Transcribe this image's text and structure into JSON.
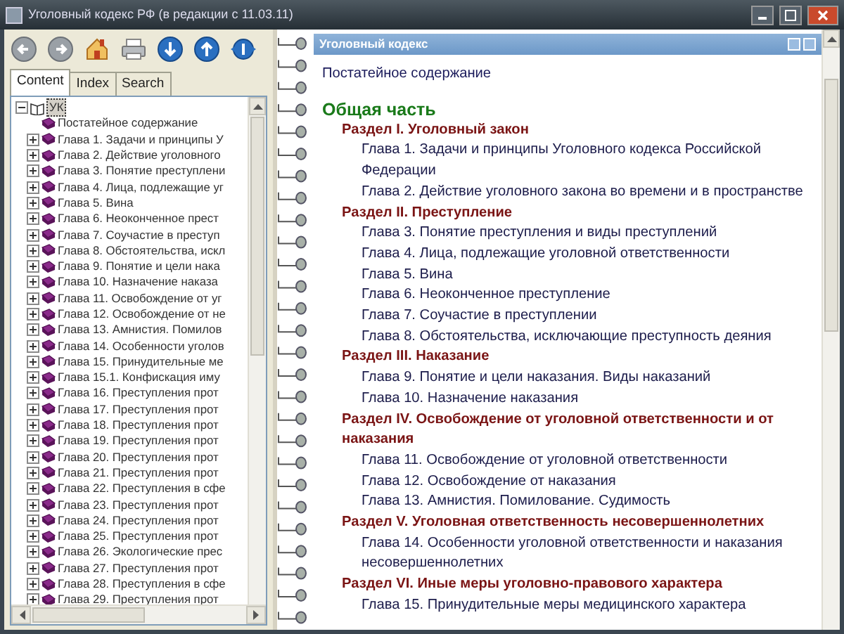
{
  "window": {
    "title": "Уголовный кодекс РФ (в редакции с 11.03.11)"
  },
  "toolbar": [
    {
      "kind": "back"
    },
    {
      "kind": "forward"
    },
    {
      "kind": "home"
    },
    {
      "kind": "print"
    },
    {
      "kind": "down"
    },
    {
      "kind": "up"
    },
    {
      "kind": "options"
    }
  ],
  "tabs": [
    {
      "label": "Content",
      "selected": true
    },
    {
      "label": "Index",
      "selected": false
    },
    {
      "label": "Search",
      "selected": false
    }
  ],
  "tree": [
    {
      "label": "УК",
      "selected": true,
      "expanded": true,
      "children": [
        {
          "label": "Постатейное содержание",
          "kind": "leaf"
        },
        {
          "label": "Глава 1. Задачи и принципы У",
          "kind": "folder"
        },
        {
          "label": "Глава 2. Действие уголовного",
          "kind": "folder"
        },
        {
          "label": "Глава 3. Понятие преступлени",
          "kind": "folder"
        },
        {
          "label": "Глава 4. Лица, подлежащие уг",
          "kind": "folder"
        },
        {
          "label": "Глава 5. Вина",
          "kind": "folder"
        },
        {
          "label": "Глава 6. Неоконченное прест",
          "kind": "folder"
        },
        {
          "label": "Глава 7. Соучастие в преступ",
          "kind": "folder"
        },
        {
          "label": "Глава 8. Обстоятельства, искл",
          "kind": "folder"
        },
        {
          "label": "Глава 9. Понятие и цели нака",
          "kind": "folder"
        },
        {
          "label": "Глава 10. Назначение наказа",
          "kind": "folder"
        },
        {
          "label": "Глава 11. Освобождение от уг",
          "kind": "folder"
        },
        {
          "label": "Глава 12. Освобождение от не",
          "kind": "folder"
        },
        {
          "label": "Глава 13. Амнистия. Помилов",
          "kind": "folder"
        },
        {
          "label": "Глава 14. Особенности уголов",
          "kind": "folder"
        },
        {
          "label": "Глава 15. Принудительные ме",
          "kind": "folder"
        },
        {
          "label": "Глава 15.1. Конфискация иму",
          "kind": "folder"
        },
        {
          "label": "Глава 16. Преступления прот",
          "kind": "folder"
        },
        {
          "label": "Глава 17. Преступления прот",
          "kind": "folder"
        },
        {
          "label": "Глава 18. Преступления прот",
          "kind": "folder"
        },
        {
          "label": "Глава 19. Преступления прот",
          "kind": "folder"
        },
        {
          "label": "Глава 20. Преступления прот",
          "kind": "folder"
        },
        {
          "label": "Глава 21. Преступления прот",
          "kind": "folder"
        },
        {
          "label": "Глава 22. Преступления в сфе",
          "kind": "folder"
        },
        {
          "label": "Глава 23. Преступления прот",
          "kind": "folder"
        },
        {
          "label": "Глава 24. Преступления прот",
          "kind": "folder"
        },
        {
          "label": "Глава 25. Преступления прот",
          "kind": "folder"
        },
        {
          "label": "Глава 26. Экологические прес",
          "kind": "folder"
        },
        {
          "label": "Глава 27. Преступления прот",
          "kind": "folder"
        },
        {
          "label": "Глава 28. Преступления в сфе",
          "kind": "folder"
        },
        {
          "label": "Глава 29. Преступления прот",
          "kind": "folder"
        }
      ]
    }
  ],
  "document": {
    "header": "Уголовный кодекс",
    "items": [
      {
        "kind": "intro",
        "text": "Постатейное содержание"
      },
      {
        "kind": "part",
        "text": "Общая часть"
      },
      {
        "kind": "section",
        "text": "Раздел I. Уголовный закон"
      },
      {
        "kind": "chapter",
        "text": "Глава 1. Задачи и принципы Уголовного кодекса Российской Федерации"
      },
      {
        "kind": "chapter",
        "text": "Глава 2. Действие уголовного закона во времени и в пространстве"
      },
      {
        "kind": "section",
        "text": "Раздел II. Преступление"
      },
      {
        "kind": "chapter",
        "text": "Глава 3. Понятие преступления и виды преступлений"
      },
      {
        "kind": "chapter",
        "text": "Глава 4. Лица, подлежащие уголовной ответственности"
      },
      {
        "kind": "chapter",
        "text": "Глава 5. Вина"
      },
      {
        "kind": "chapter",
        "text": "Глава 6. Неоконченное преступление"
      },
      {
        "kind": "chapter",
        "text": "Глава 7. Соучастие в преступлении"
      },
      {
        "kind": "chapter",
        "text": "Глава 8. Обстоятельства, исключающие преступность деяния"
      },
      {
        "kind": "section",
        "text": "Раздел III. Наказание"
      },
      {
        "kind": "chapter",
        "text": "Глава 9. Понятие и цели наказания. Виды наказаний"
      },
      {
        "kind": "chapter",
        "text": "Глава 10. Назначение наказания"
      },
      {
        "kind": "section",
        "text": "Раздел IV. Освобождение от уголовной ответственности и от наказания"
      },
      {
        "kind": "chapter",
        "text": "Глава 11. Освобождение от уголовной ответственности"
      },
      {
        "kind": "chapter",
        "text": "Глава 12. Освобождение от наказания"
      },
      {
        "kind": "chapter",
        "text": "Глава 13. Амнистия. Помилование. Судимость"
      },
      {
        "kind": "section",
        "text": "Раздел V. Уголовная ответственность несовершеннолетних"
      },
      {
        "kind": "chapter",
        "text": "Глава 14. Особенности уголовной ответственности и наказания несовершеннолетних"
      },
      {
        "kind": "section",
        "text": "Раздел VI. Иные меры уголовно-правового характера"
      },
      {
        "kind": "chapter",
        "text": "Глава 15. Принудительные меры медицинского характера"
      }
    ]
  }
}
